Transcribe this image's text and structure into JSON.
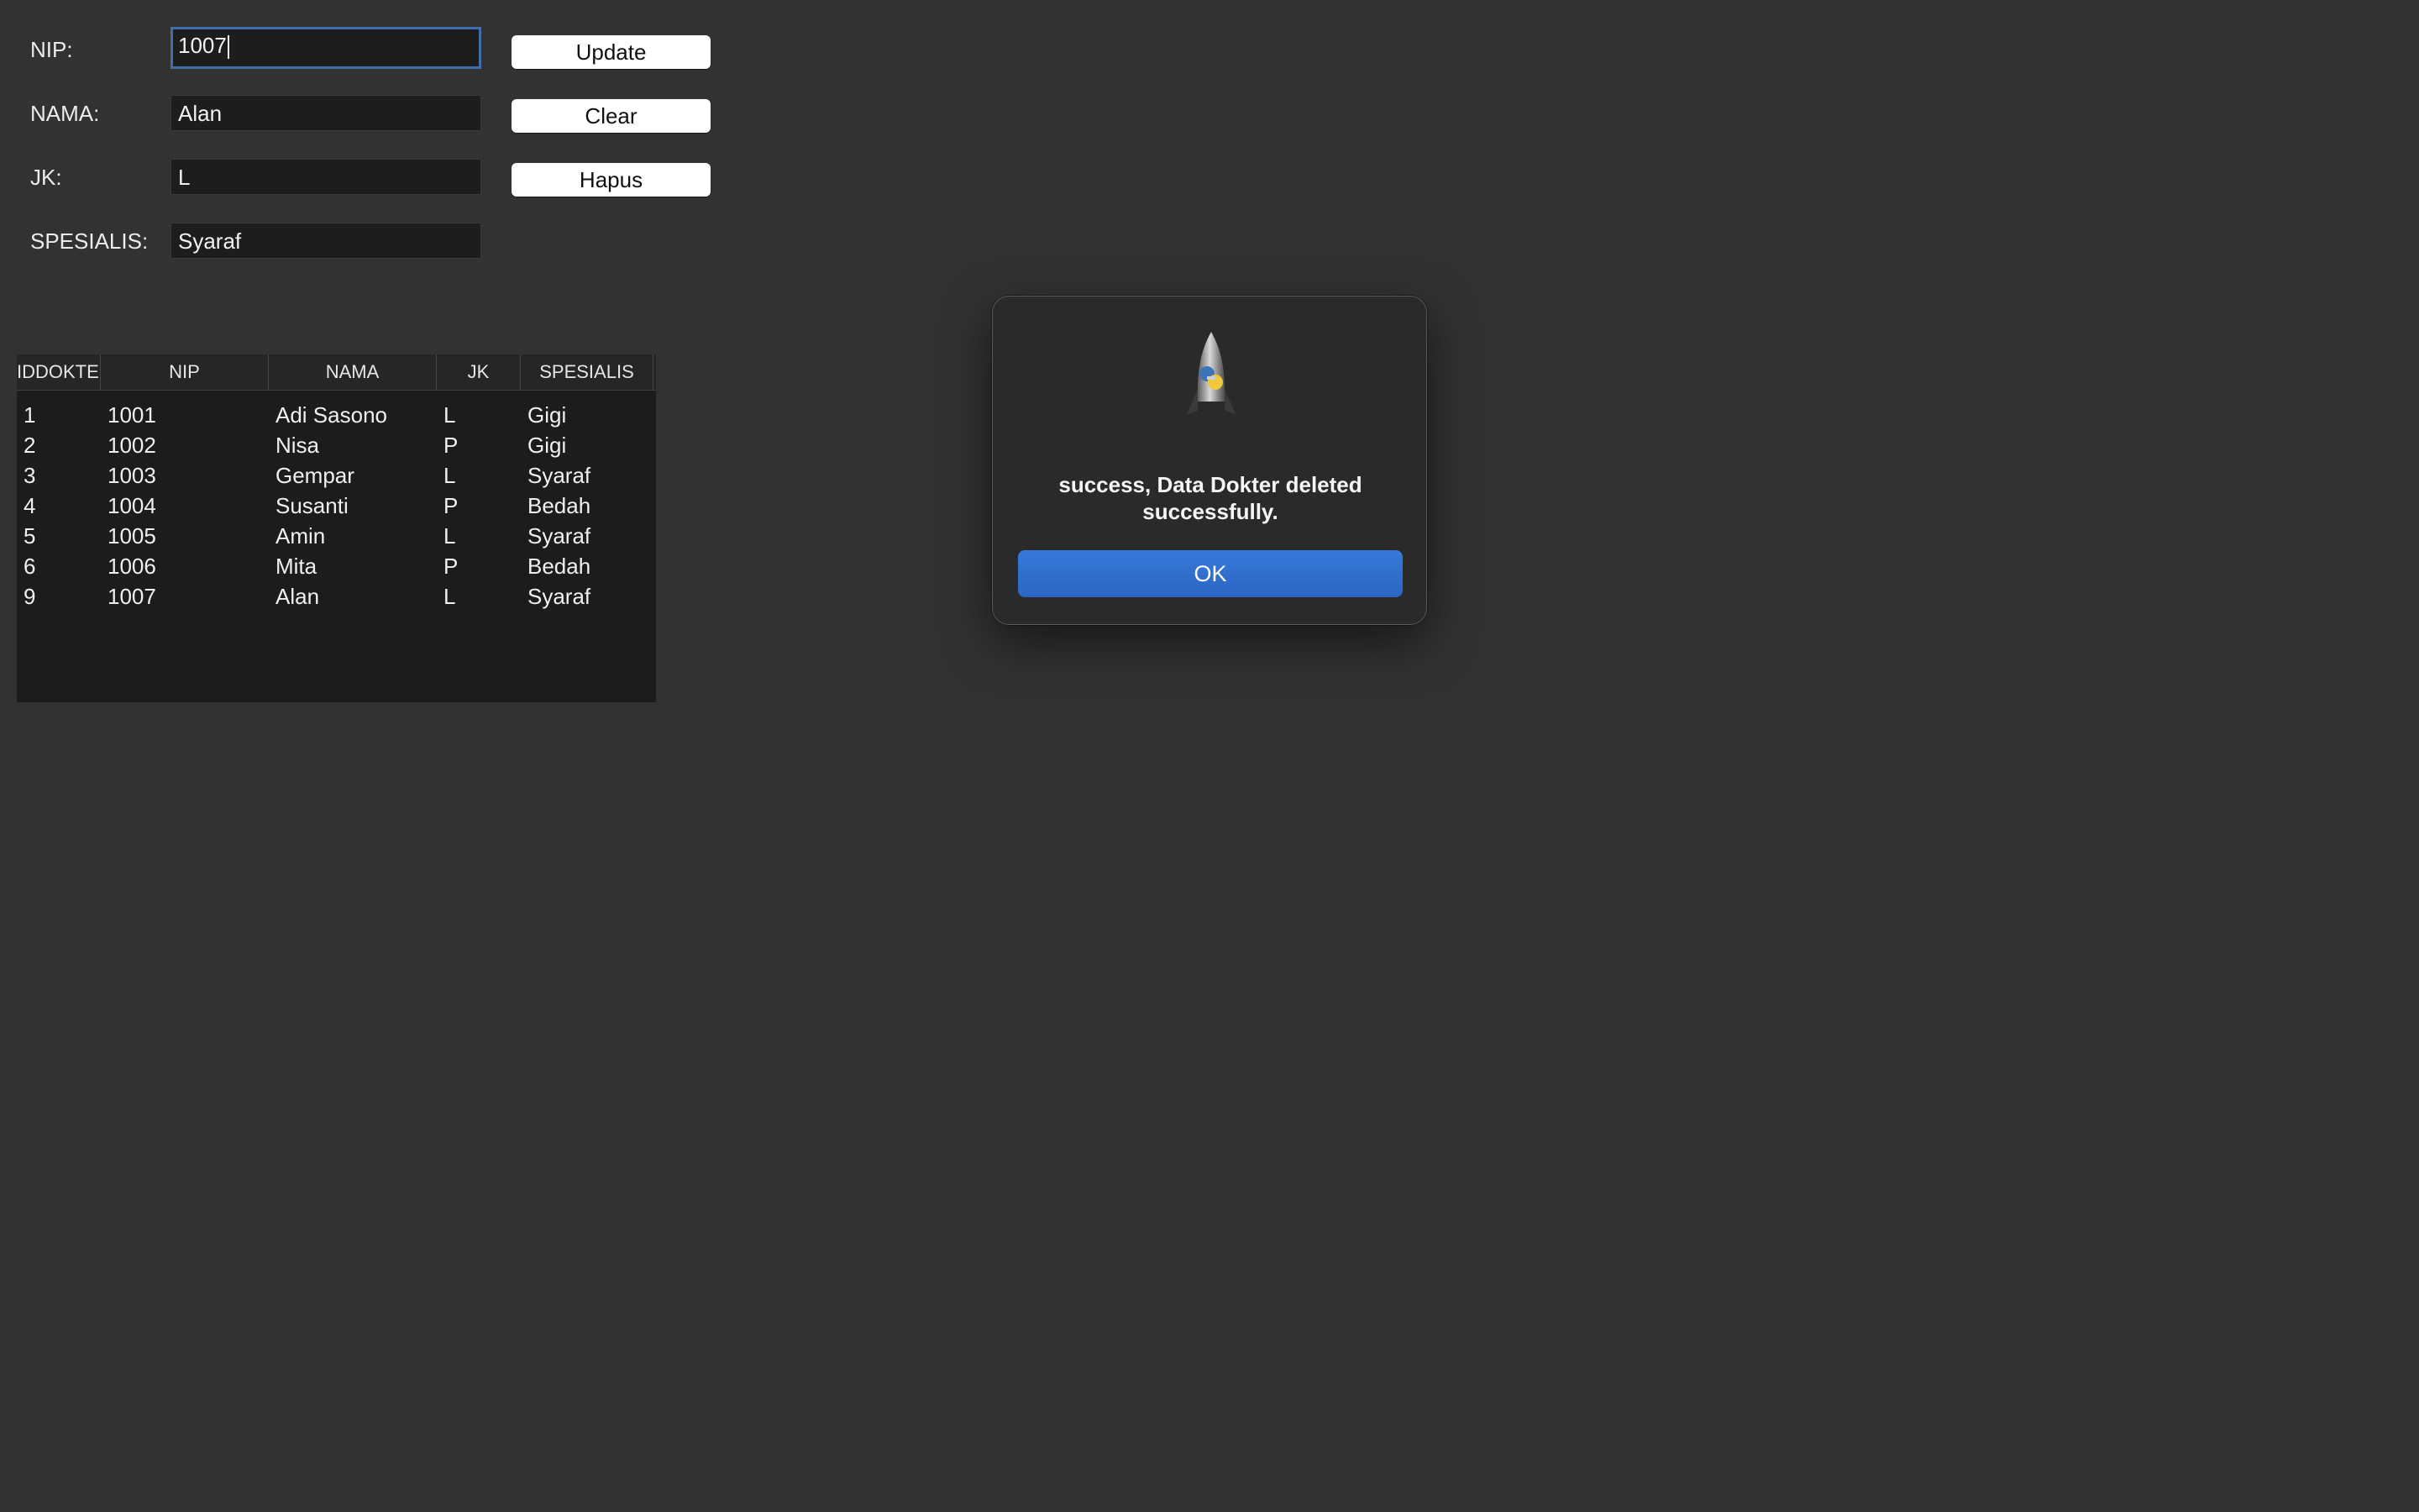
{
  "form": {
    "nip": {
      "label": "NIP:",
      "value": "1007"
    },
    "nama": {
      "label": "NAMA:",
      "value": "Alan"
    },
    "jk": {
      "label": "JK:",
      "value": "L"
    },
    "spesialis": {
      "label": "SPESIALIS:",
      "value": "Syaraf"
    }
  },
  "buttons": {
    "update": "Update",
    "clear": "Clear",
    "hapus": "Hapus"
  },
  "table": {
    "columns": [
      "IDDOKTER",
      "NIP",
      "NAMA",
      "JK",
      "SPESIALIS"
    ],
    "rows": [
      [
        "1",
        "1001",
        "Adi Sasono",
        "L",
        "Gigi"
      ],
      [
        "2",
        "1002",
        "Nisa",
        "P",
        "Gigi"
      ],
      [
        "3",
        "1003",
        "Gempar",
        "L",
        "Syaraf"
      ],
      [
        "4",
        "1004",
        "Susanti",
        "P",
        "Bedah"
      ],
      [
        "5",
        "1005",
        "Amin",
        "L",
        "Syaraf"
      ],
      [
        "6",
        "1006",
        "Mita",
        "P",
        "Bedah"
      ],
      [
        "9",
        "1007",
        "Alan",
        "L",
        "Syaraf"
      ]
    ]
  },
  "dialog": {
    "icon": "python-rocket-icon",
    "message": "success, Data Dokter deleted successfully.",
    "ok_label": "OK"
  },
  "colors": {
    "background": "#323232",
    "focus_ring": "#3f6ea8",
    "ok_button": "#2f6ed0"
  }
}
